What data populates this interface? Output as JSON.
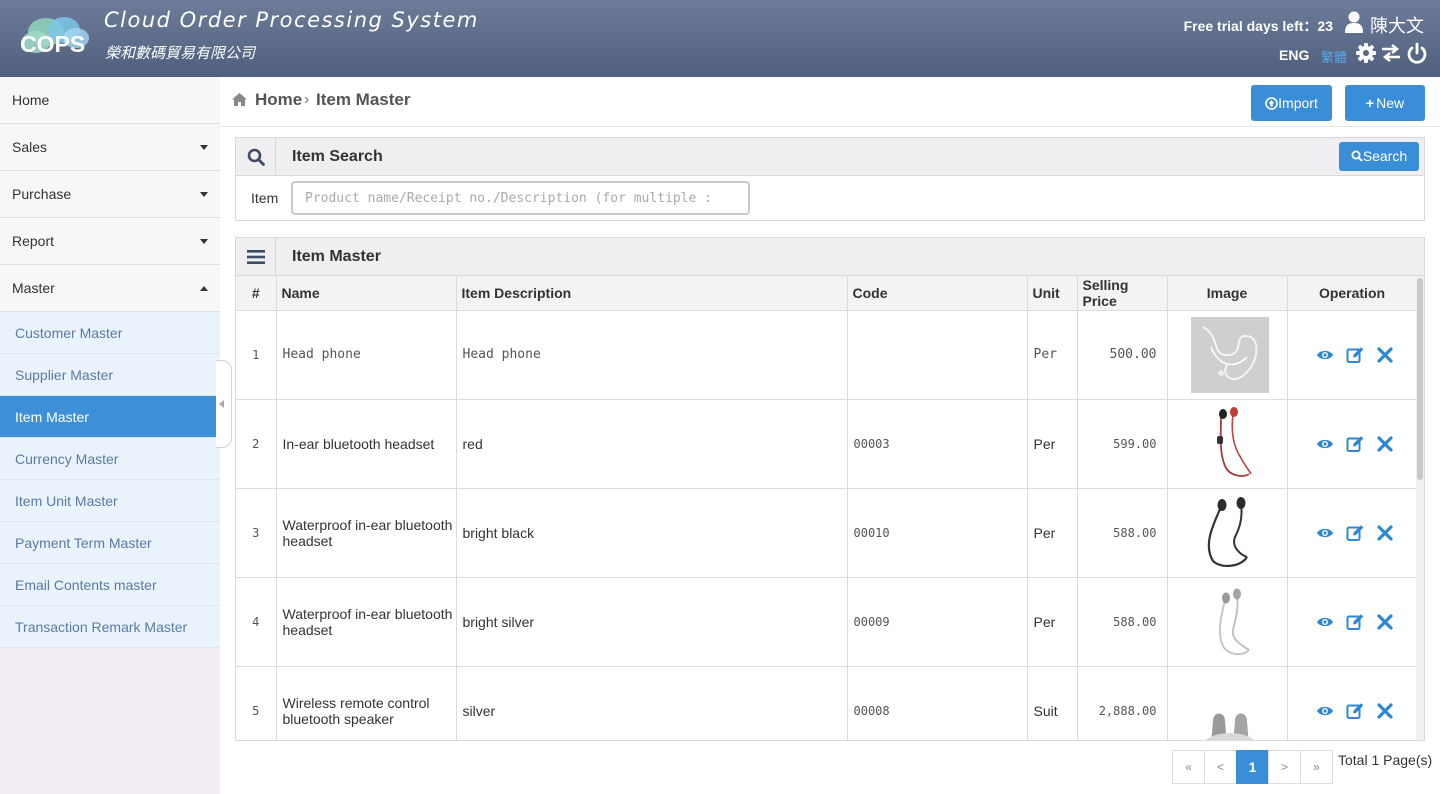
{
  "header": {
    "logo_text": "COPS",
    "title": "Cloud Order Processing System",
    "subtitle": "榮和數碼貿易有限公司",
    "trial": "Free trial days left：23",
    "user_name": "陳大文",
    "lang_eng": "ENG",
    "lang_zh": "繁體",
    "colors": {
      "bar_top": "#6d7c99",
      "bar_bottom": "#4f5f7d"
    }
  },
  "sidebar": {
    "items": [
      {
        "label": "Home",
        "caret": "none"
      },
      {
        "label": "Sales",
        "caret": "down"
      },
      {
        "label": "Purchase",
        "caret": "down"
      },
      {
        "label": "Report",
        "caret": "down"
      },
      {
        "label": "Master",
        "caret": "up"
      }
    ],
    "sub_items": [
      {
        "label": "Customer Master"
      },
      {
        "label": "Supplier Master"
      },
      {
        "label": "Item Master",
        "active": true
      },
      {
        "label": "Currency Master"
      },
      {
        "label": "Item Unit Master"
      },
      {
        "label": "Payment Term Master"
      },
      {
        "label": "Email Contents master"
      },
      {
        "label": "Transaction Remark Master"
      }
    ],
    "active_color": "#3d8fd8"
  },
  "breadcrumb": {
    "home": "Home",
    "separator": "›",
    "current": "Item Master"
  },
  "actions": {
    "import_label": "Import",
    "new_label": "New",
    "accent": "#3a8ed8"
  },
  "search": {
    "title": "Item Search",
    "button_label": "Search",
    "item_label": "Item",
    "placeholder": "Product name/Receipt no./Description (for multiple :",
    "value": ""
  },
  "table": {
    "title": "Item Master",
    "columns": [
      "#",
      "Name",
      "Item Description",
      "Code",
      "Unit",
      "Selling Price",
      "Image",
      "Operation"
    ],
    "rows": [
      {
        "no": "1",
        "name": "Head phone",
        "desc": "Head phone",
        "code": "",
        "unit": "Per",
        "price": "500.00",
        "image": "wired-earphones",
        "mono": true
      },
      {
        "no": "2",
        "name": "In-ear bluetooth headset",
        "desc": "red",
        "code": "00003",
        "unit": "Per",
        "price": "599.00",
        "image": "red-neckband-earphones",
        "mono": false
      },
      {
        "no": "3",
        "name": "Waterproof in-ear bluetooth headset",
        "desc": "bright black",
        "code": "00010",
        "unit": "Per",
        "price": "588.00",
        "image": "black-neckband-earphones",
        "mono": false
      },
      {
        "no": "4",
        "name": "Waterproof in-ear bluetooth headset",
        "desc": "bright silver",
        "code": "00009",
        "unit": "Per",
        "price": "588.00",
        "image": "silver-neckband-earphones",
        "mono": false
      },
      {
        "no": "5",
        "name": "Wireless remote control bluetooth speaker",
        "desc": "silver",
        "code": "00008",
        "unit": "Suit",
        "price": "2,888.00",
        "image": "speaker-set",
        "mono": false
      }
    ]
  },
  "pagination": {
    "first": "«",
    "prev": "<",
    "current": "1",
    "next": ">",
    "last": "»",
    "total": "Total 1 Page(s)"
  }
}
